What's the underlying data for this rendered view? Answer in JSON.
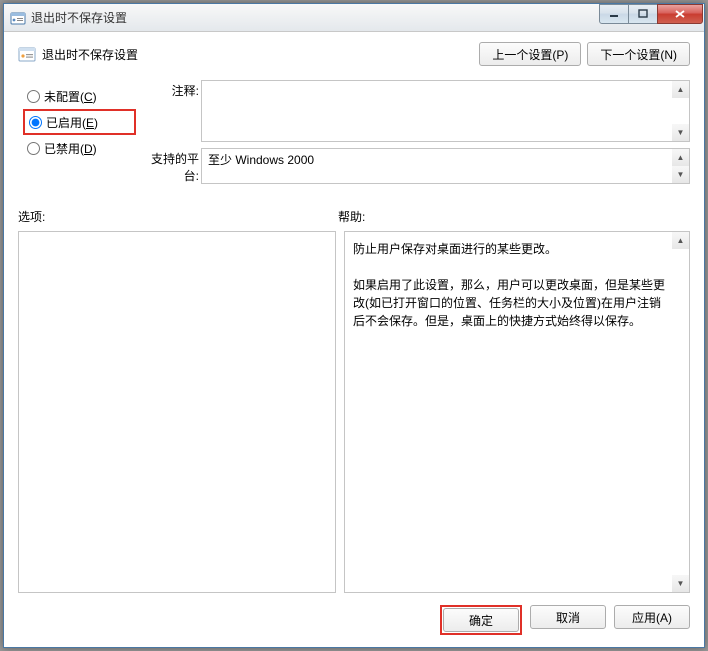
{
  "window": {
    "title": "退出时不保存设置"
  },
  "header": {
    "policy_title": "退出时不保存设置",
    "prev_btn": "上一个设置(P)",
    "next_btn": "下一个设置(N)"
  },
  "radios": {
    "not_configured": {
      "label": "未配置(",
      "hotkey": "C",
      "suffix": ")"
    },
    "enabled": {
      "label": "已启用(",
      "hotkey": "E",
      "suffix": ")"
    },
    "disabled": {
      "label": "已禁用(",
      "hotkey": "D",
      "suffix": ")"
    }
  },
  "fields": {
    "comment_label": "注释:",
    "comment_value": "",
    "platform_label": "支持的平台:",
    "platform_value": "至少 Windows 2000"
  },
  "labels": {
    "options": "选项:",
    "help": "帮助:"
  },
  "help_text": {
    "p1": "防止用户保存对桌面进行的某些更改。",
    "p2": "如果启用了此设置，那么，用户可以更改桌面，但是某些更改(如已打开窗口的位置、任务栏的大小及位置)在用户注销后不会保存。但是，桌面上的快捷方式始终得以保存。"
  },
  "buttons": {
    "ok": "确定",
    "cancel": "取消",
    "apply": "应用(A)"
  }
}
